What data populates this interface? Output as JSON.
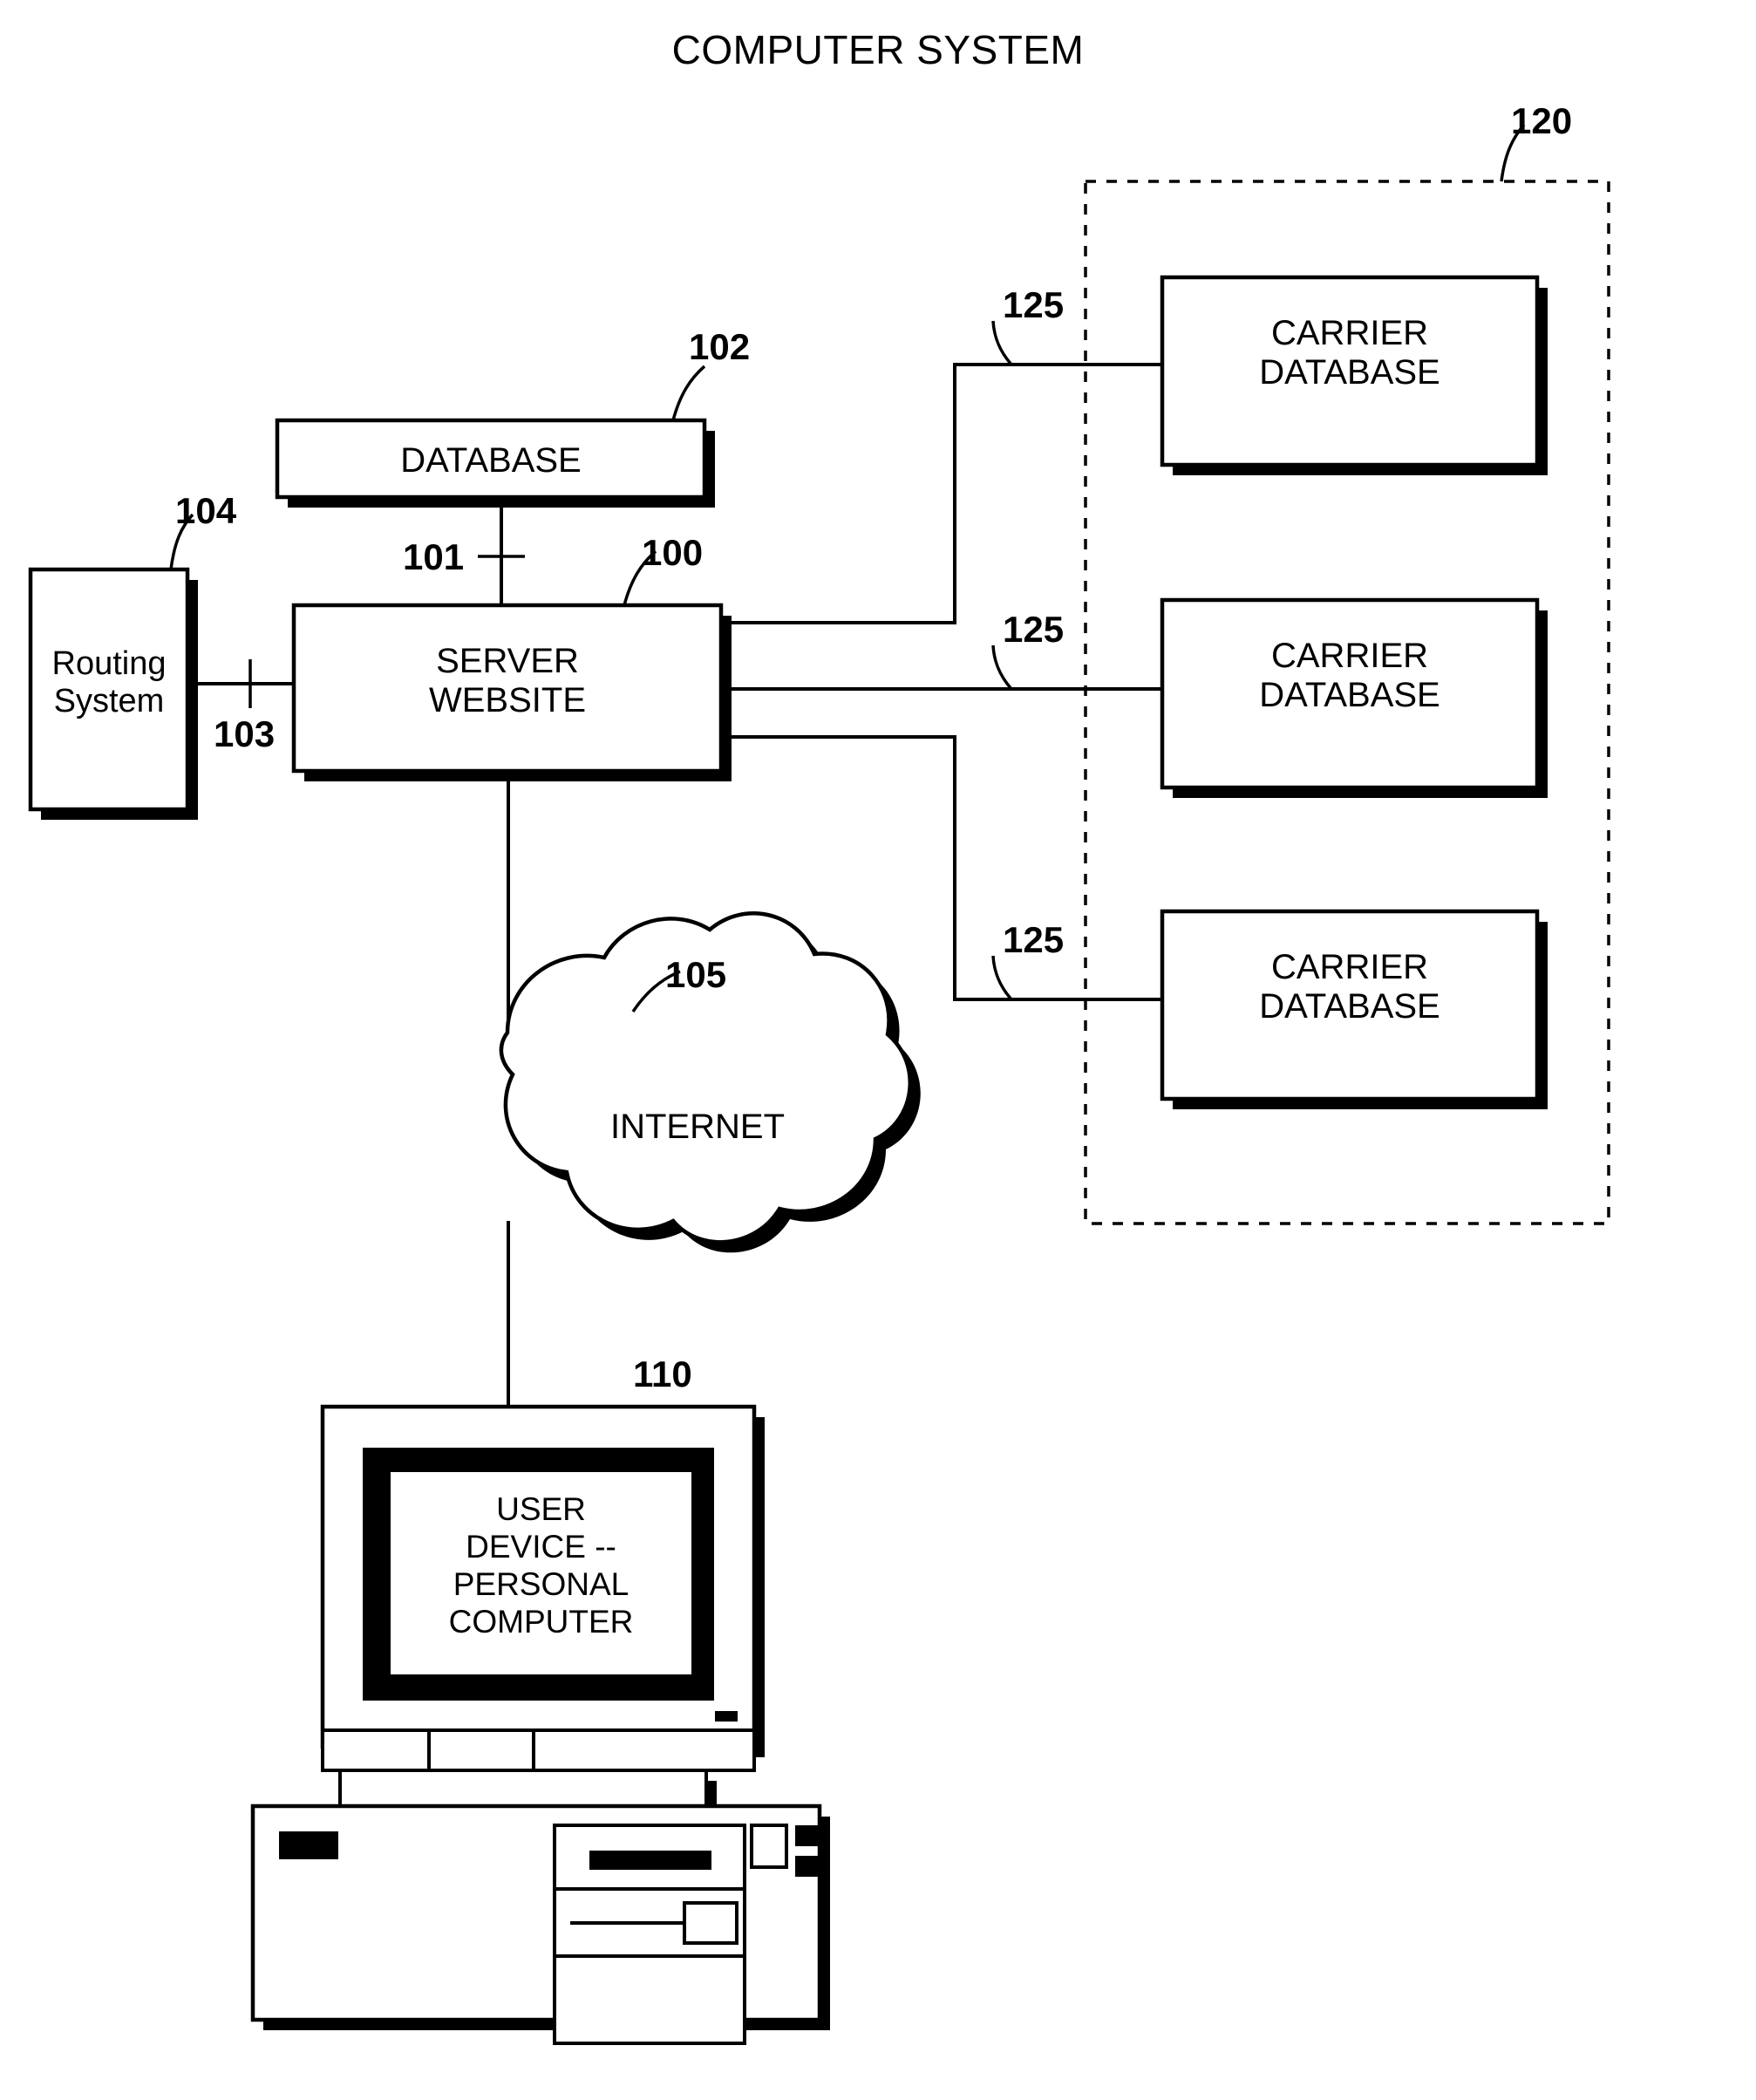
{
  "figure": {
    "title": "COMPUTER SYSTEM",
    "type": "patent-block-diagram"
  },
  "nodes": {
    "database": {
      "label": "DATABASE",
      "ref": "102"
    },
    "routing_system": {
      "label_line1": "Routing",
      "label_line2": "System",
      "ref": "104"
    },
    "server_website": {
      "label_line1": "SERVER",
      "label_line2": "WEBSITE",
      "ref": "100"
    },
    "internet": {
      "label": "INTERNET",
      "ref": "105"
    },
    "user_device": {
      "label_line1": "USER",
      "label_line2": "DEVICE --",
      "label_line3": "PERSONAL",
      "label_line4": "COMPUTER",
      "ref": "110"
    },
    "carrier_group": {
      "ref": "120"
    },
    "carrier_databases": [
      {
        "label_line1": "CARRIER",
        "label_line2": "DATABASE",
        "ref": "125"
      },
      {
        "label_line1": "CARRIER",
        "label_line2": "DATABASE",
        "ref": "125"
      },
      {
        "label_line1": "CARRIER",
        "label_line2": "DATABASE",
        "ref": "125"
      }
    ]
  },
  "links": {
    "database_to_server": {
      "ref": "101"
    },
    "routing_to_server": {
      "ref": "103"
    }
  },
  "colors": {
    "line": "#000000",
    "fill": "#ffffff",
    "shadow": "#000000",
    "background": "#ffffff"
  }
}
